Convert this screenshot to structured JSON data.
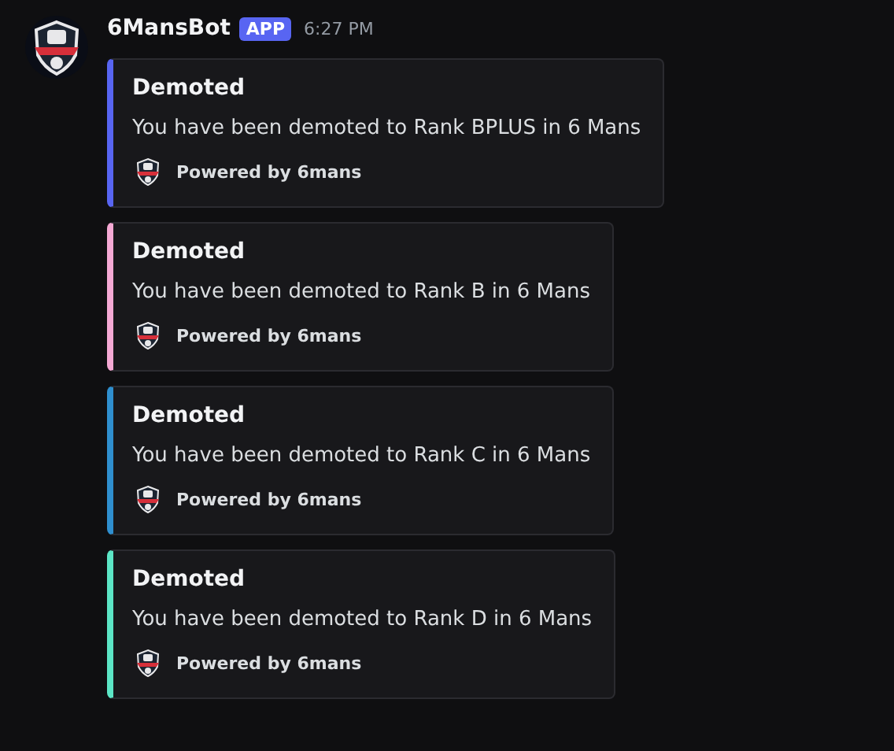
{
  "message": {
    "author": "6MansBot",
    "badge": "APP",
    "time": "6:27 PM"
  },
  "embeds": [
    {
      "title": "Demoted",
      "description": "You have been demoted to Rank BPLUS in 6 Mans",
      "footer": "Powered by 6mans",
      "color": "#5865f2"
    },
    {
      "title": "Demoted",
      "description": "You have been demoted to Rank B in 6 Mans",
      "footer": "Powered by 6mans",
      "color": "#f5a9d4"
    },
    {
      "title": "Demoted",
      "description": "You have been demoted to Rank C in 6 Mans",
      "footer": "Powered by 6mans",
      "color": "#2f8fcf"
    },
    {
      "title": "Demoted",
      "description": "You have been demoted to Rank D in 6 Mans",
      "footer": "Powered by 6mans",
      "color": "#5ce6c6"
    }
  ]
}
